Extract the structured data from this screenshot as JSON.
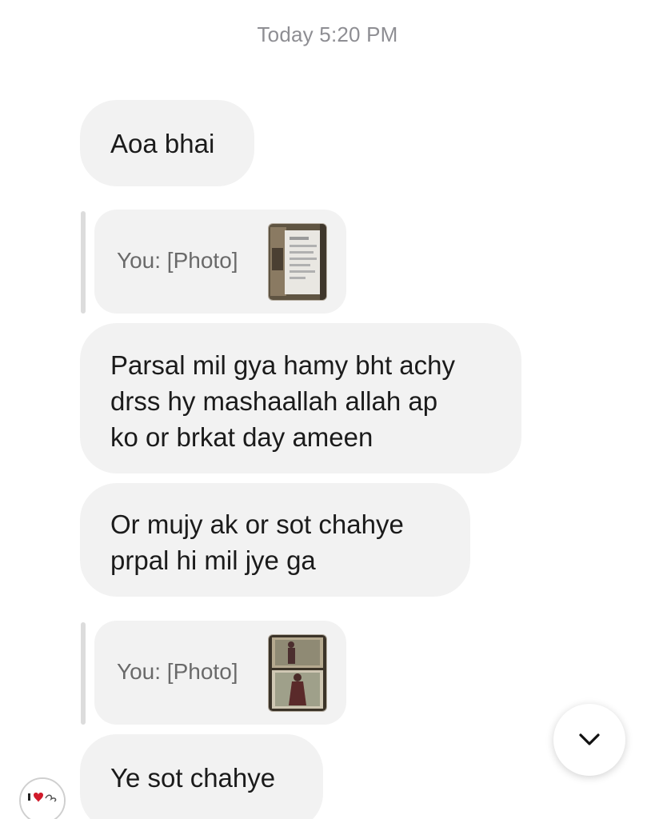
{
  "header": {
    "timestamp": "Today 5:20 PM"
  },
  "messages": [
    {
      "type": "text",
      "text": "Aoa bhai"
    },
    {
      "type": "reply",
      "text": "You: [Photo]",
      "thumbnail": "photo-thumbnail"
    },
    {
      "type": "text",
      "lines": [
        "Parsal mil gya hamy bht achy",
        "drss hy mashaallah allah ap",
        "ko or brkat day ameen"
      ]
    },
    {
      "type": "text",
      "lines": [
        "Or mujy ak or sot chahye",
        "prpal hi mil jye ga"
      ]
    },
    {
      "type": "reply",
      "text": "You: [Photo]",
      "thumbnail": "photo-thumbnail"
    },
    {
      "type": "text",
      "text": "Ye sot chahye"
    }
  ],
  "controls": {
    "scroll_down_icon": "chevron-down-icon"
  },
  "avatar": {
    "icon": "avatar-heart"
  },
  "colors": {
    "bubble": "#f2f2f2",
    "text": "#1b1b1b",
    "timestamp": "#8e8e93",
    "reply_text": "#6a6a6a",
    "reply_bar": "#dcdcdc"
  }
}
